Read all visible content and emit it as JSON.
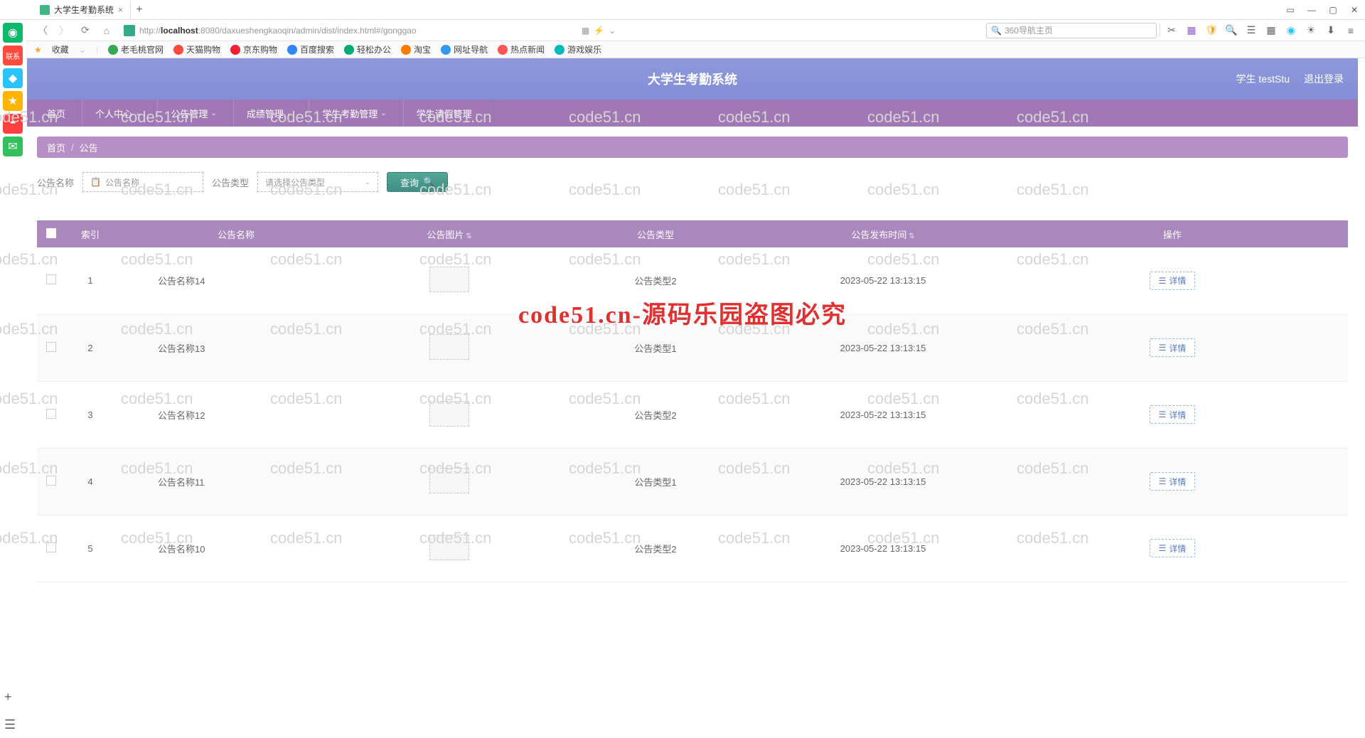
{
  "browser": {
    "tab_title": "大学生考勤系统",
    "url_prefix": "http://",
    "url_host": "localhost",
    "url_rest": ":8080/daxueshengkaoqin/admin/dist/index.html#/gonggao",
    "search_placeholder": "360导航主页",
    "bookmarks_label": "收藏",
    "bookmarks": [
      "老毛桃官网",
      "天猫购物",
      "京东购物",
      "百度搜索",
      "轻松办公",
      "淘宝",
      "网址导航",
      "热点新闻",
      "游戏娱乐"
    ]
  },
  "app": {
    "title": "大学生考勤系统",
    "user_label": "学生 testStu",
    "logout": "退出登录",
    "nav": [
      {
        "label": "首页",
        "caret": false
      },
      {
        "label": "个人中心",
        "caret": true
      },
      {
        "label": "公告管理",
        "caret": true
      },
      {
        "label": "成绩管理",
        "caret": true
      },
      {
        "label": "学生考勤管理",
        "caret": true
      },
      {
        "label": "学生请假管理",
        "caret": true
      }
    ],
    "crumb_home": "首页",
    "crumb_current": "公告",
    "filter": {
      "name_label": "公告名称",
      "name_placeholder": "公告名称",
      "type_label": "公告类型",
      "type_placeholder": "请选择公告类型",
      "query": "查询"
    },
    "columns": {
      "index": "索引",
      "name": "公告名称",
      "image": "公告图片",
      "type": "公告类型",
      "time": "公告发布时间",
      "action": "操作"
    },
    "detail_label": "详情",
    "rows": [
      {
        "idx": "1",
        "name": "公告名称14",
        "type": "公告类型2",
        "time": "2023-05-22 13:13:15"
      },
      {
        "idx": "2",
        "name": "公告名称13",
        "type": "公告类型1",
        "time": "2023-05-22 13:13:15"
      },
      {
        "idx": "3",
        "name": "公告名称12",
        "type": "公告类型2",
        "time": "2023-05-22 13:13:15"
      },
      {
        "idx": "4",
        "name": "公告名称11",
        "type": "公告类型1",
        "time": "2023-05-22 13:13:15"
      },
      {
        "idx": "5",
        "name": "公告名称10",
        "type": "公告类型2",
        "time": "2023-05-22 13:13:15"
      }
    ]
  },
  "watermark": {
    "text": "code51.cn",
    "red": "code51.cn-源码乐园盗图必究"
  }
}
